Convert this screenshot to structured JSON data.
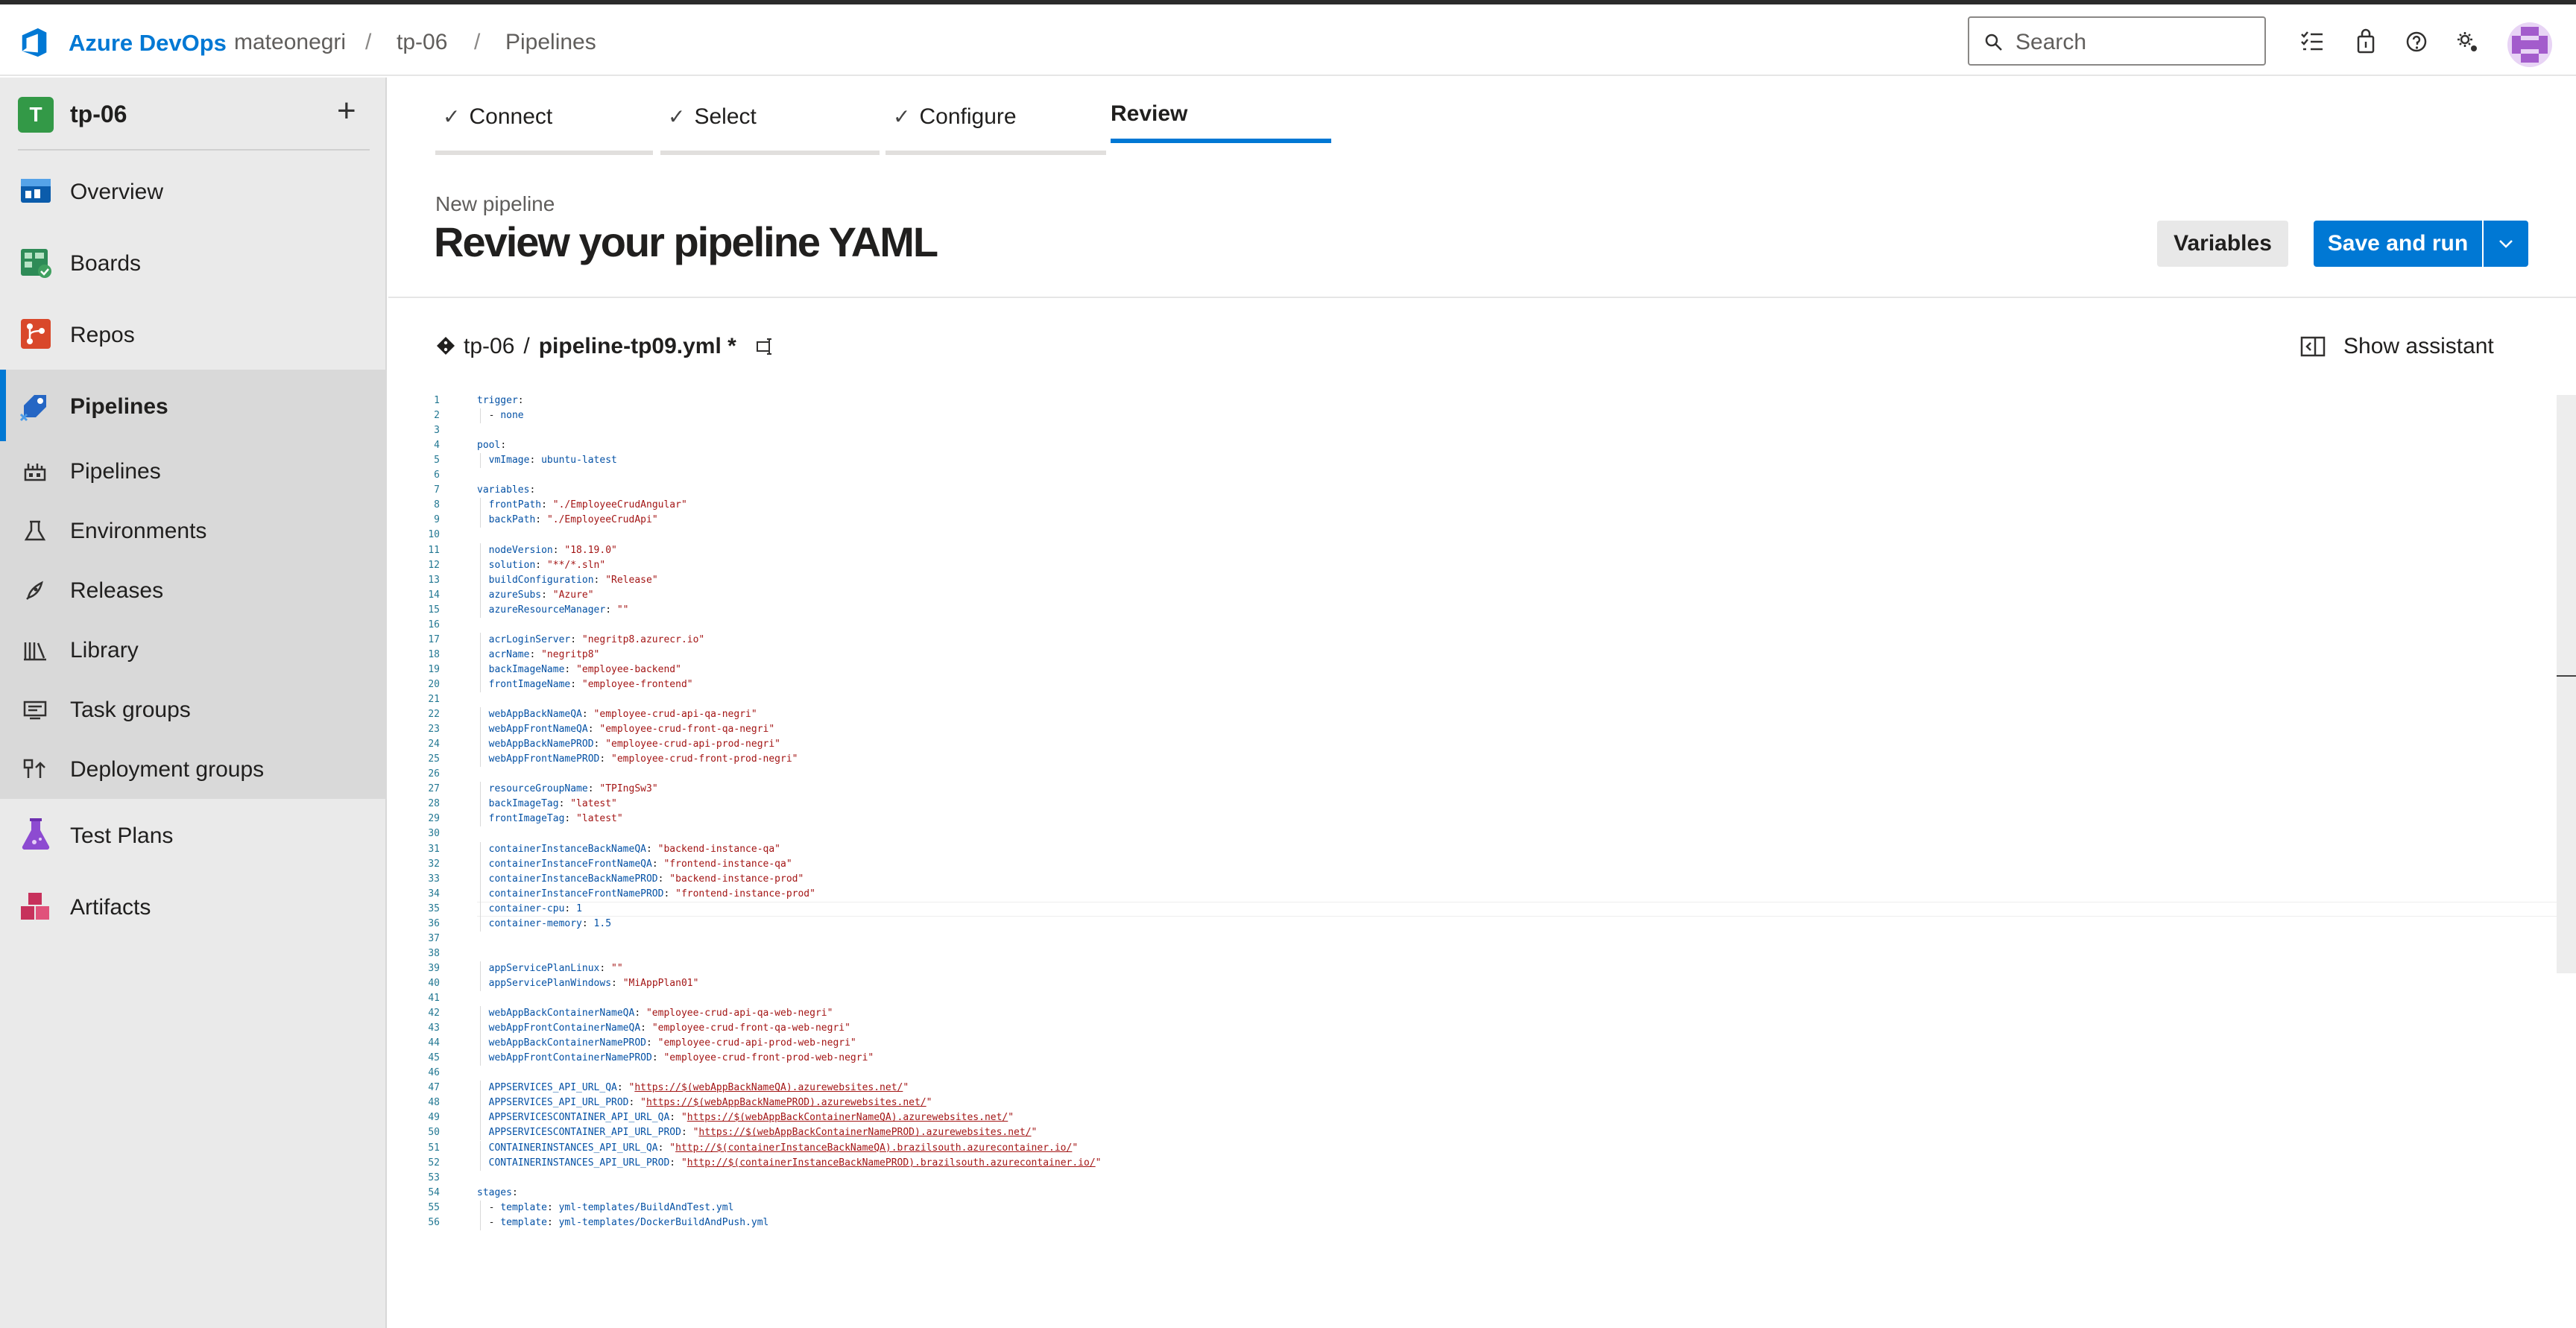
{
  "topbar": {
    "brand": "Azure DevOps",
    "breadcrumb": [
      "mateonegri",
      "tp-06",
      "Pipelines"
    ],
    "search_placeholder": "Search"
  },
  "sidebar": {
    "project_initial": "T",
    "project_name": "tp-06",
    "add_label": "+",
    "items": [
      {
        "label": "Overview",
        "icon": "overview-icon"
      },
      {
        "label": "Boards",
        "icon": "boards-icon"
      },
      {
        "label": "Repos",
        "icon": "repos-icon"
      },
      {
        "label": "Pipelines",
        "icon": "pipelines-icon"
      }
    ],
    "sub_items": [
      {
        "label": "Pipelines",
        "icon": "pipelines-sub-icon"
      },
      {
        "label": "Environments",
        "icon": "environments-icon"
      },
      {
        "label": "Releases",
        "icon": "releases-icon"
      },
      {
        "label": "Library",
        "icon": "library-icon"
      },
      {
        "label": "Task groups",
        "icon": "task-groups-icon"
      },
      {
        "label": "Deployment groups",
        "icon": "deployment-groups-icon"
      }
    ],
    "bottom_items": [
      {
        "label": "Test Plans",
        "icon": "test-plans-icon"
      },
      {
        "label": "Artifacts",
        "icon": "artifacts-icon"
      }
    ]
  },
  "wizard": {
    "steps": [
      {
        "label": "Connect",
        "done": true
      },
      {
        "label": "Select",
        "done": true
      },
      {
        "label": "Configure",
        "done": true
      },
      {
        "label": "Review",
        "done": false,
        "active": true
      }
    ]
  },
  "header": {
    "subtitle": "New pipeline",
    "title": "Review your pipeline YAML",
    "variables_label": "Variables",
    "save_run_label": "Save and run"
  },
  "file": {
    "repo": "tp-06",
    "separator": "/",
    "filename": "pipeline-tp09.yml *",
    "assistant_label": "Show assistant"
  },
  "editor": {
    "lines": [
      "trigger:",
      "  - none",
      "",
      "pool:",
      "  vmImage: ubuntu-latest",
      "",
      "variables:",
      "  frontPath: \"./EmployeeCrudAngular\"",
      "  backPath: \"./EmployeeCrudApi\"",
      "",
      "  nodeVersion: \"18.19.0\"",
      "  solution: \"**/*.sln\"",
      "  buildConfiguration: \"Release\"",
      "  azureSubs: \"Azure\"",
      "  azureResourceManager: \"\"",
      "",
      "  acrLoginServer: \"negritp8.azurecr.io\"",
      "  acrName: \"negritp8\"",
      "  backImageName: \"employee-backend\"",
      "  frontImageName: \"employee-frontend\"",
      "",
      "  webAppBackNameQA: \"employee-crud-api-qa-negri\"",
      "  webAppFrontNameQA: \"employee-crud-front-qa-negri\"",
      "  webAppBackNamePROD: \"employee-crud-api-prod-negri\"",
      "  webAppFrontNamePROD: \"employee-crud-front-prod-negri\"",
      "",
      "  resourceGroupName: \"TPIngSw3\"",
      "  backImageTag: \"latest\"",
      "  frontImageTag: \"latest\"",
      "",
      "  containerInstanceBackNameQA: \"backend-instance-qa\"",
      "  containerInstanceFrontNameQA: \"frontend-instance-qa\"",
      "  containerInstanceBackNamePROD: \"backend-instance-prod\"",
      "  containerInstanceFrontNamePROD: \"frontend-instance-prod\"",
      "  container-cpu: 1",
      "  container-memory: 1.5",
      "",
      "",
      "  appServicePlanLinux: \"\"",
      "  appServicePlanWindows: \"MiAppPlan01\"",
      "",
      "  webAppBackContainerNameQA: \"employee-crud-api-qa-web-negri\"",
      "  webAppFrontContainerNameQA: \"employee-crud-front-qa-web-negri\"",
      "  webAppBackContainerNamePROD: \"employee-crud-api-prod-web-negri\"",
      "  webAppFrontContainerNamePROD: \"employee-crud-front-prod-web-negri\"",
      "",
      "  APPSERVICES_API_URL_QA: \"https://$(webAppBackNameQA).azurewebsites.net/\"",
      "  APPSERVICES_API_URL_PROD: \"https://$(webAppBackNamePROD).azurewebsites.net/\"",
      "  APPSERVICESCONTAINER_API_URL_QA: \"https://$(webAppBackContainerNameQA).azurewebsites.net/\"",
      "  APPSERVICESCONTAINER_API_URL_PROD: \"https://$(webAppBackContainerNamePROD).azurewebsites.net/\"",
      "  CONTAINERINSTANCES_API_URL_QA: \"http://$(containerInstanceBackNameQA).brazilsouth.azurecontainer.io/\"",
      "  CONTAINERINSTANCES_API_URL_PROD: \"http://$(containerInstanceBackNamePROD).brazilsouth.azurecontainer.io/\"",
      "",
      "stages:",
      "  - template: yml-templates/BuildAndTest.yml",
      "  - template: yml-templates/DockerBuildAndPush.yml"
    ]
  },
  "colors": {
    "accent": "#0078d4",
    "sidebar_bg": "#eaeaea",
    "project_badge": "#339947"
  }
}
